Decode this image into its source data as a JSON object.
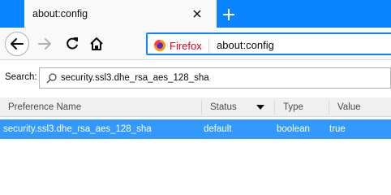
{
  "tab": {
    "title": "about:config"
  },
  "navbar": {
    "identity_label": "Firefox",
    "url": "about:config"
  },
  "search": {
    "label": "Search:",
    "value": "security.ssl3.dhe_rsa_aes_128_sha"
  },
  "table": {
    "columns": [
      "Preference Name",
      "Status",
      "Type",
      "Value"
    ],
    "rows": [
      {
        "name": "security.ssl3.dhe_rsa_aes_128_sha",
        "status": "default",
        "type": "boolean",
        "value": "true"
      }
    ]
  },
  "icons": {
    "close_tab": "close-icon",
    "new_tab": "plus-icon",
    "back": "arrow-left-icon",
    "forward": "arrow-right-icon",
    "reload": "reload-icon",
    "home": "home-icon",
    "identity": "firefox-logo-icon",
    "search": "magnifier-icon",
    "sort": "sort-down-icon"
  },
  "colors": {
    "tabstrip": "#0a84ff",
    "selected_row": "#3399ff",
    "identity_text": "#d70022"
  }
}
